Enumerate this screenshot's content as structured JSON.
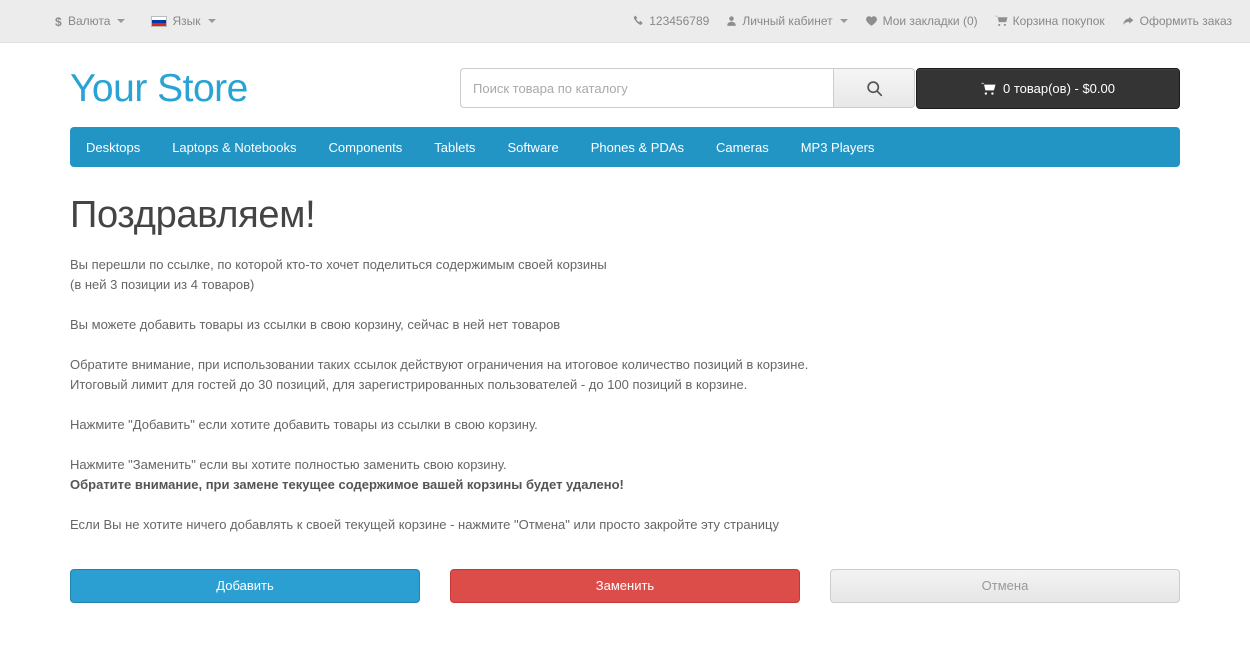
{
  "topbar": {
    "left": [
      {
        "name": "currency-selector",
        "icon": "dollar-icon",
        "label": "Валюта",
        "caret": true
      },
      {
        "name": "language-selector",
        "icon": "flag-ru-icon",
        "label": "Язык",
        "caret": true
      }
    ],
    "right": [
      {
        "name": "phone-link",
        "icon": "phone-icon",
        "label": "123456789",
        "caret": false
      },
      {
        "name": "account-link",
        "icon": "user-icon",
        "label": "Личный кабинет",
        "caret": true
      },
      {
        "name": "wishlist-link",
        "icon": "heart-icon",
        "label": "Мои закладки (0)",
        "caret": false
      },
      {
        "name": "shopping-cart-link",
        "icon": "cart-icon",
        "label": "Корзина покупок",
        "caret": false
      },
      {
        "name": "checkout-link",
        "icon": "share-arrow-icon",
        "label": "Оформить заказ",
        "caret": false
      }
    ]
  },
  "header": {
    "logo": "Your Store",
    "search": {
      "placeholder": "Поиск товара по каталогу",
      "value": "",
      "button_icon": "search-icon"
    },
    "cart": {
      "icon": "cart-icon",
      "label": "0 товар(ов) - $0.00"
    }
  },
  "nav": {
    "items": [
      "Desktops",
      "Laptops & Notebooks",
      "Components",
      "Tablets",
      "Software",
      "Phones & PDAs",
      "Cameras",
      "MP3 Players"
    ]
  },
  "main": {
    "title": "Поздравляем!",
    "paragraphs": [
      "Вы перешли по ссылке, по которой кто-то хочет поделиться содержимым своей корзины",
      "(в ней 3 позиции из 4 товаров)",
      "Вы можете добавить товары из ссылки в свою корзину, сейчас в ней нет товаров",
      "Обратите внимание, при использовании таких ссылок действуют ограничения на итоговое количество позиций в корзине.",
      "Итоговый лимит для гостей до 30 позиций, для зарегистрированных пользователей - до 100 позиций в корзине.",
      "Нажмите \"Добавить\" если хотите добавить товары из ссылки в свою корзину.",
      "Нажмите \"Заменить\" если вы хотите полностью заменить свою корзину.",
      "Обратите внимание, при замене текущее содержимое вашей корзины будет удалено!",
      "Если Вы не хотите ничего добавлять к своей текущей корзине - нажмите \"Отмена\" или просто закройте эту страницу"
    ]
  },
  "actions": {
    "add": "Добавить",
    "replace": "Заменить",
    "cancel": "Отмена"
  },
  "colors": {
    "brand_blue": "#29a3d4",
    "nav_blue": "#2395c5",
    "btn_add": "#2b9fd1",
    "btn_replace": "#dc4c48",
    "topbar_bg": "#ececec",
    "cart_dark": "#343434"
  }
}
